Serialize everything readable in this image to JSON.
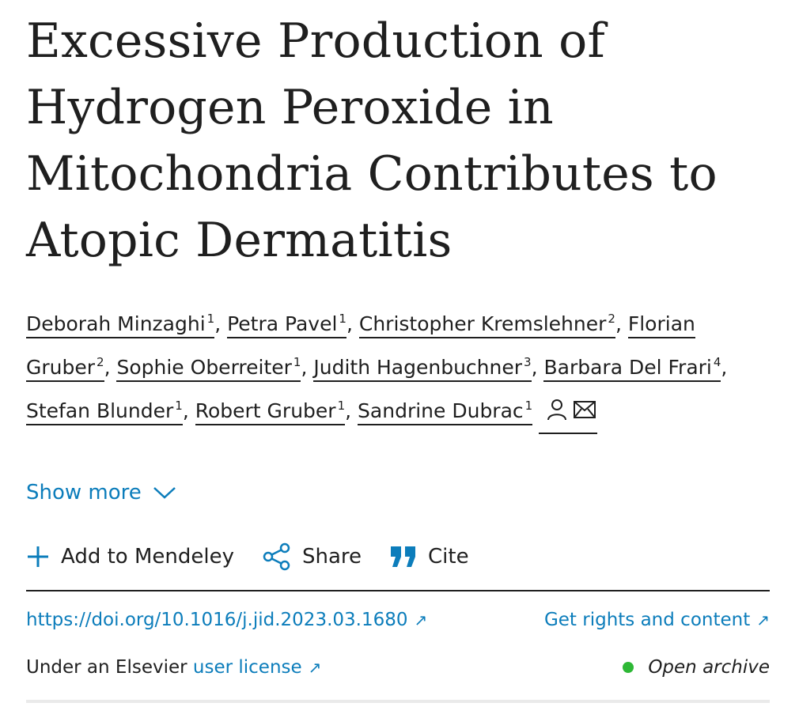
{
  "article": {
    "title": "Excessive Production of Hydrogen Peroxide in Mitochondria Contributes to Atopic Dermatitis",
    "authors": [
      {
        "name": "Deborah Minzaghi",
        "aff": "1"
      },
      {
        "name": "Petra Pavel",
        "aff": "1"
      },
      {
        "name": "Christopher Kremslehner",
        "aff": "2"
      },
      {
        "name": "Florian Gruber",
        "aff": "2"
      },
      {
        "name": "Sophie Oberreiter",
        "aff": "1"
      },
      {
        "name": "Judith Hagenbuchner",
        "aff": "3"
      },
      {
        "name": "Barbara Del Frari",
        "aff": "4"
      },
      {
        "name": "Stefan Blunder",
        "aff": "1"
      },
      {
        "name": "Robert Gruber",
        "aff": "1"
      },
      {
        "name": "Sandrine Dubrac",
        "aff": "1"
      }
    ],
    "show_more": "Show more",
    "actions": {
      "mendeley": "Add to Mendeley",
      "share": "Share",
      "cite": "Cite"
    },
    "doi": "https://doi.org/10.1016/j.jid.2023.03.1680",
    "rights": "Get rights and content",
    "license_prefix": "Under an Elsevier",
    "license_link": "user license",
    "open_archive": "Open archive",
    "colors": {
      "link": "#0c7dbb",
      "open_dot": "#2eb836"
    }
  }
}
